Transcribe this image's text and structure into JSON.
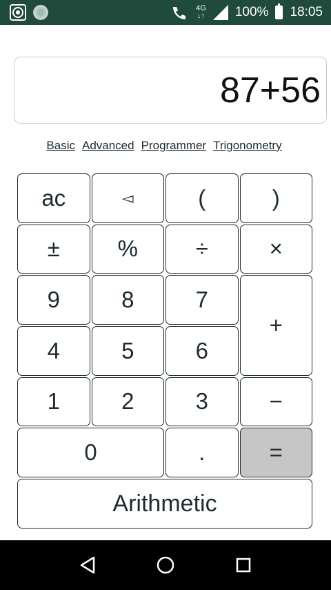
{
  "status_bar": {
    "network": "LTE",
    "network_type": "4G",
    "battery": "100%",
    "time": "18:05"
  },
  "display": {
    "expression": "87+56"
  },
  "modes": [
    "Basic",
    "Advanced",
    "Programmer",
    "Trigonometry"
  ],
  "keys": {
    "ac": "ac",
    "backspace": "◅",
    "open_paren": "(",
    "close_paren": ")",
    "plus_minus": "±",
    "percent": "%",
    "divide": "÷",
    "multiply": "×",
    "seven": "7",
    "eight": "8",
    "nine": "9",
    "plus": "+",
    "four": "4",
    "five": "5",
    "six": "6",
    "one": "1",
    "two": "2",
    "three": "3",
    "minus": "−",
    "zero": "0",
    "dot": ".",
    "equals": "="
  },
  "arithmetic_button": "Arithmetic",
  "colors": {
    "status_bar_bg": "#1f4a3c",
    "key_border": "#1e2a32",
    "equals_bg": "#c6c6c6"
  }
}
